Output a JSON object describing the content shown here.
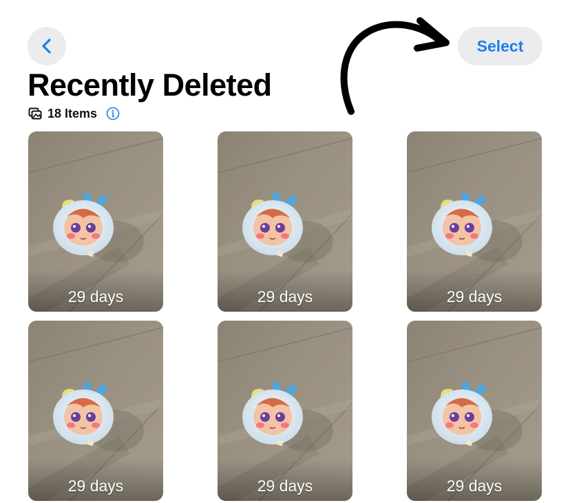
{
  "header": {
    "back_icon": "chevron-left-icon",
    "select_label": "Select",
    "title": "Recently Deleted",
    "count_label": "18 Items",
    "photos_icon": "photo-stack-icon",
    "info_icon": "info-circle-icon"
  },
  "colors": {
    "accent": "#1e7cf0",
    "button_bg": "#ececee"
  },
  "annotation": {
    "arrow_icon": "curved-arrow-icon"
  },
  "grid": {
    "items": [
      {
        "days_label": "29 days"
      },
      {
        "days_label": "29 days"
      },
      {
        "days_label": "29 days"
      },
      {
        "days_label": "29 days"
      },
      {
        "days_label": "29 days"
      },
      {
        "days_label": "29 days"
      }
    ]
  }
}
